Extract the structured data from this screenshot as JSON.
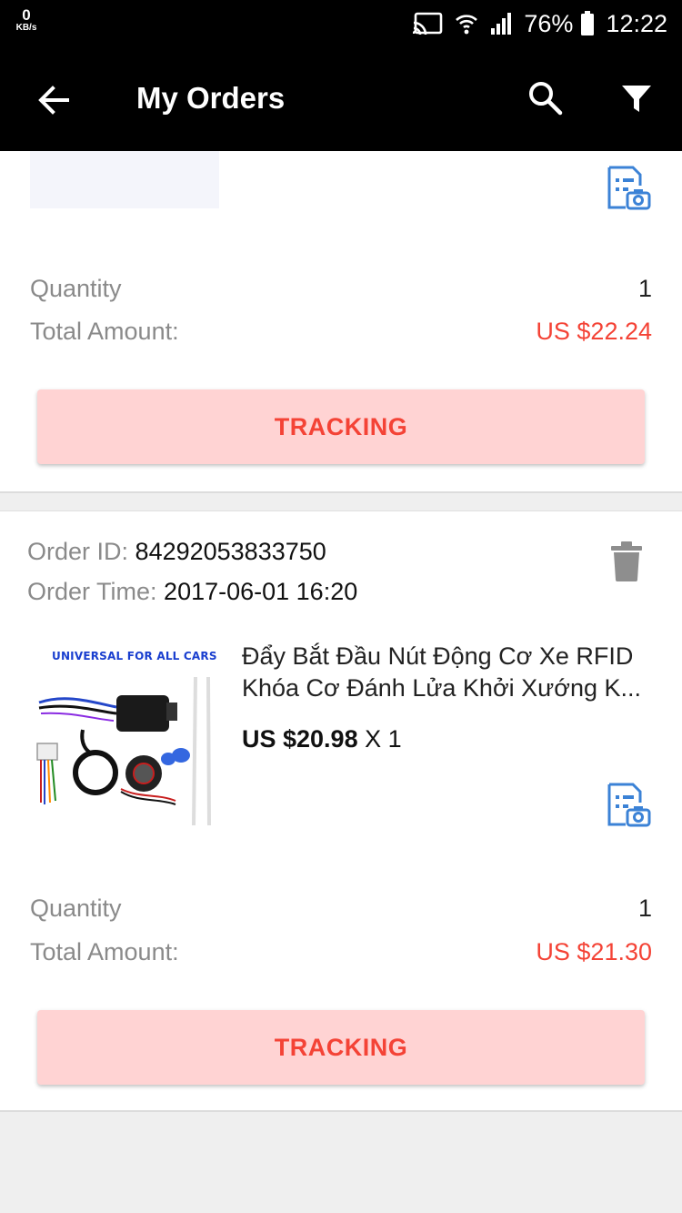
{
  "status_bar": {
    "net_speed": "0",
    "net_unit": "KB/s",
    "battery": "76%",
    "time": "12:22"
  },
  "app_bar": {
    "title": "My Orders",
    "icons": [
      "back-arrow-icon",
      "search-icon",
      "filter-icon"
    ]
  },
  "orders": [
    {
      "quantity_label": "Quantity",
      "quantity": "1",
      "total_label": "Total Amount:",
      "total": "US $22.24",
      "tracking_label": "TRACKING"
    },
    {
      "order_id_label": "Order ID:",
      "order_id": "84292053833750",
      "order_time_label": "Order Time:",
      "order_time": "2017-06-01 16:20",
      "product": {
        "image_banner": "UNIVERSAL FOR ALL CARS",
        "title_line1": "Đẩy Bắt Đầu Nút Động Cơ Xe RFID",
        "title_line2": "Khóa Cơ Đánh Lửa Khởi Xướng K...",
        "price": "US $20.98",
        "qty_suffix": "X 1"
      },
      "quantity_label": "Quantity",
      "quantity": "1",
      "total_label": "Total Amount:",
      "total": "US $21.30",
      "tracking_label": "TRACKING"
    }
  ],
  "colors": {
    "accent": "#f44336",
    "button_bg": "#ffd3d3",
    "icon_blue": "#3b82d6",
    "header_bg": "#000000"
  }
}
